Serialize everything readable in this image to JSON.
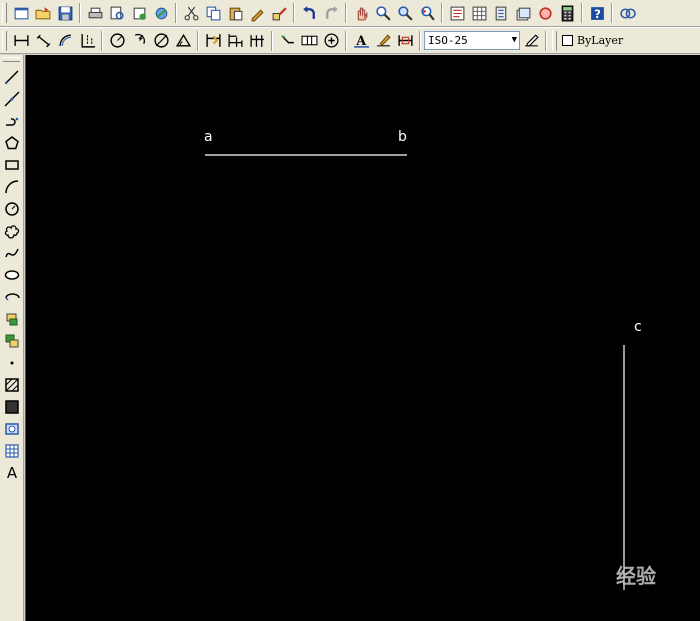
{
  "toolbar_standard": {
    "icons": [
      "new-icon",
      "open-icon",
      "save-icon",
      "plot-icon",
      "plot-preview-icon",
      "publish-icon",
      "3d-dwf-icon",
      "cut-icon",
      "copy-icon",
      "paste-icon",
      "match-properties-icon",
      "block-editor-icon",
      "undo-icon",
      "redo-icon",
      "pan-icon",
      "zoom-realtime-icon",
      "zoom-window-icon",
      "zoom-previous-icon",
      "properties-icon",
      "design-center-icon",
      "tool-palettes-icon",
      "sheet-set-icon",
      "markup-icon",
      "calculator-icon",
      "help-icon"
    ]
  },
  "toolbar_dimension": {
    "dim_style": "ISO-25",
    "layer_value": "ByLayer"
  },
  "draw_toolbar": {
    "text_tool_label": "A",
    "icons": [
      "line-icon",
      "construction-line-icon",
      "polyline-icon",
      "polygon-icon",
      "rectangle-icon",
      "arc-icon",
      "circle-icon",
      "revision-cloud-icon",
      "spline-icon",
      "ellipse-icon",
      "ellipse-arc-icon",
      "insert-block-icon",
      "make-block-icon",
      "point-icon",
      "hatch-icon",
      "gradient-icon",
      "region-icon",
      "table-icon",
      "multiline-text-icon"
    ]
  },
  "drawing": {
    "label_a": "a",
    "label_b": "b",
    "label_c": "c",
    "line_color": "#ffffff",
    "background": "#000000"
  },
  "watermark": "经验"
}
